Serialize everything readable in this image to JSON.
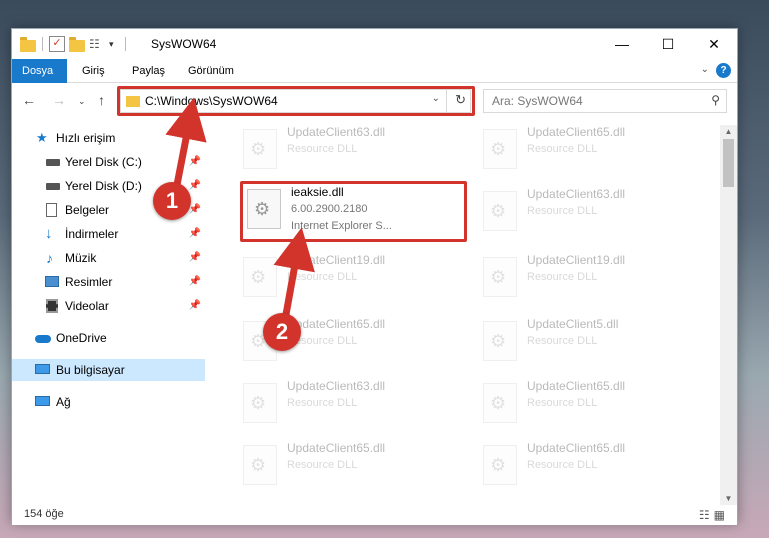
{
  "window": {
    "title": "SysWOW64",
    "controls": {
      "minimize": "—",
      "maximize": "☐",
      "close": "✕"
    }
  },
  "ribbon": {
    "tabs": [
      "Dosya",
      "Giriş",
      "Paylaş",
      "Görünüm"
    ],
    "help": "?"
  },
  "nav": {
    "address_path": "C:\\Windows\\SysWOW64",
    "search_placeholder": "Ara: SysWOW64"
  },
  "sidebar": {
    "items": [
      {
        "label": "Hızlı erişim",
        "icon": "star-icon"
      },
      {
        "label": "Yerel Disk (C:)",
        "icon": "drive-icon",
        "pinned": true
      },
      {
        "label": "Yerel Disk (D:)",
        "icon": "drive-icon",
        "pinned": true
      },
      {
        "label": "Belgeler",
        "icon": "document-icon",
        "pinned": true
      },
      {
        "label": "İndirmeler",
        "icon": "download-icon",
        "pinned": true
      },
      {
        "label": "Müzik",
        "icon": "music-icon",
        "pinned": true
      },
      {
        "label": "Resimler",
        "icon": "pictures-icon",
        "pinned": true
      },
      {
        "label": "Videolar",
        "icon": "video-icon",
        "pinned": true
      },
      {
        "label": "OneDrive",
        "icon": "cloud-icon"
      },
      {
        "label": "Bu bilgisayar",
        "icon": "computer-icon",
        "selected": true
      },
      {
        "label": "Ağ",
        "icon": "network-icon"
      }
    ]
  },
  "files": {
    "highlighted": {
      "name": "ieaksie.dll",
      "version": "6.00.2900.2180",
      "description": "Internet Explorer S..."
    },
    "faded": [
      {
        "name": "UpdateClient63.dll",
        "type": "Resource DLL"
      },
      {
        "name": "UpdateClient65.dll",
        "type": "Resource DLL"
      },
      {
        "name": "UpdateClient63.dll",
        "type": "Resource DLL"
      },
      {
        "name": "UpdateClient19.dll",
        "type": "Resource DLL"
      },
      {
        "name": "UpdateClient19.dll",
        "type": "Resource DLL"
      },
      {
        "name": "UpdateClient65.dll",
        "type": "Resource DLL"
      },
      {
        "name": "UpdateClient5.dll",
        "type": "Resource DLL"
      },
      {
        "name": "UpdateClient63.dll",
        "type": "Resource DLL"
      },
      {
        "name": "UpdateClient65.dll",
        "type": "Resource DLL"
      },
      {
        "name": "UpdateClient65.dll",
        "type": "Resource DLL"
      },
      {
        "name": "UpdateClient65.dll",
        "type": "Resource DLL"
      }
    ]
  },
  "status": {
    "item_count": "154 öğe"
  },
  "callouts": [
    "1",
    "2"
  ],
  "colors": {
    "accent": "#1979ca",
    "highlight_red": "#d2342c",
    "selection": "#cce8ff"
  }
}
